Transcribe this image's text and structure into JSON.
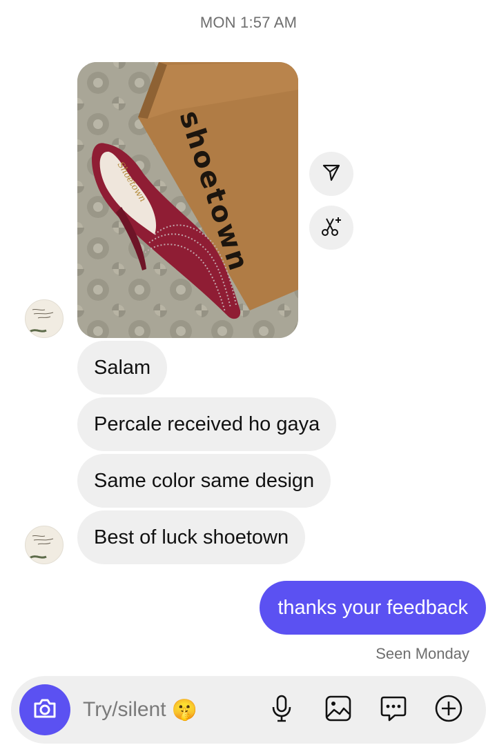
{
  "thread": {
    "timestamp": "MON 1:57 AM",
    "seen": "Seen Monday"
  },
  "photo": {
    "box_text": "shoetown",
    "insole_text": "Shoetown"
  },
  "side_actions": [
    {
      "icon": "share-icon"
    },
    {
      "icon": "remix-icon"
    }
  ],
  "messages_in": [
    {
      "text": "Salam"
    },
    {
      "text": "Percale received ho gaya"
    },
    {
      "text": "Same color same design"
    },
    {
      "text": "Best of luck shoetown"
    }
  ],
  "messages_out": [
    {
      "text": "thanks your feedback"
    }
  ],
  "composer": {
    "placeholder": "Try/silent",
    "emoji": "🤫",
    "tools": [
      "microphone-icon",
      "gallery-icon",
      "sticker-icon",
      "plus-icon"
    ]
  },
  "colors": {
    "accent": "#5b51f2",
    "bubble_in": "#efefef",
    "meta_text": "#6e6e6e"
  }
}
